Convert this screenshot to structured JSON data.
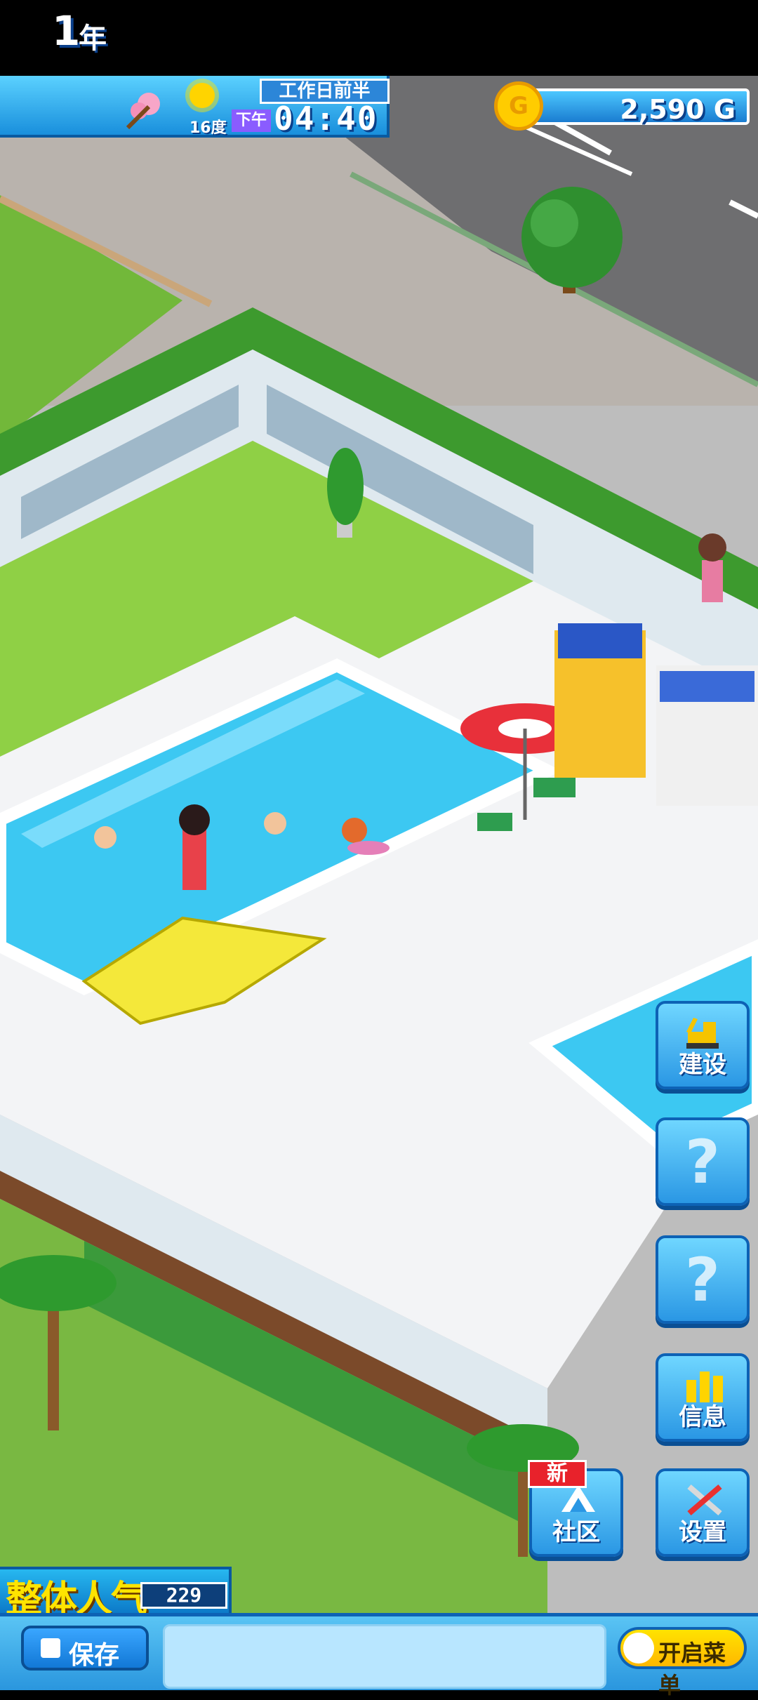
{
  "hud": {
    "year_number": "1",
    "year_label": "年",
    "temperature": "16度",
    "phase": "工作日前半",
    "ampm": "下午",
    "clock": "04:40",
    "money": "2,590 G",
    "coin_symbol": "G"
  },
  "side_buttons": {
    "build": "建设",
    "unknown1": "?",
    "unknown2": "?",
    "info": "信息",
    "community": "社区",
    "community_badge": "新",
    "settings": "设置"
  },
  "popularity": {
    "label": "整体人气",
    "value": "229"
  },
  "bottom_bar": {
    "save_label": "保存",
    "menu_label": "开启菜单"
  },
  "colors": {
    "hud_blue": "#198fdc",
    "pool_water": "#3cc8f2",
    "grass": "#7cc43a",
    "deck": "#f3f4f6"
  }
}
